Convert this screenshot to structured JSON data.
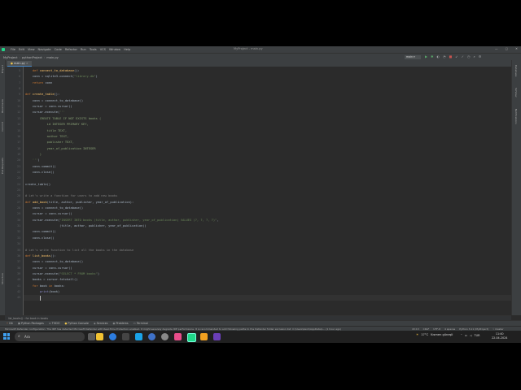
{
  "window": {
    "title": "MyProject - main.py",
    "menu": [
      "File",
      "Edit",
      "View",
      "Navigate",
      "Code",
      "Refactor",
      "Run",
      "Tools",
      "VCS",
      "Window",
      "Help"
    ],
    "controls": [
      "—",
      "▢",
      "✕"
    ]
  },
  "navbar": {
    "project": "MyProject",
    "folder": "pythonProject",
    "file": "main.py",
    "run_config": "main"
  },
  "tabs": [
    {
      "label": "main.py",
      "active": true
    }
  ],
  "side_left": [
    "Project",
    "Bookmarks",
    "Commit",
    "Pull Requests",
    "Structure"
  ],
  "side_right": [
    "Database",
    "SciView",
    "Notifications"
  ],
  "code_lines": [
    {
      "n": "5",
      "html": "    <span class='kw'>def</span> <span class='fn'>connect_to_database</span>():"
    },
    {
      "n": "6",
      "html": "    conn = sqlite3.connect(<span class='str'>\"library.db\"</span>)"
    },
    {
      "n": "7",
      "html": "    <span class='kw'>return</span> conn"
    },
    {
      "n": "8",
      "html": ""
    },
    {
      "n": "9",
      "html": "<span class='kw'>def</span> <span class='fn'>create_table</span>():"
    },
    {
      "n": "10",
      "html": "    conn = connect_to_database()"
    },
    {
      "n": "11",
      "html": "    cursor = conn.cursor()"
    },
    {
      "n": "12",
      "html": "    cursor.execute(<span class='str'>'''</span>"
    },
    {
      "n": "13",
      "html": "<span class='sqlstr'>        CREATE TABLE IF NOT EXISTS books (</span>"
    },
    {
      "n": "14",
      "html": "<span class='sqlstr'>            id INTEGER PRIMARY KEY,</span>"
    },
    {
      "n": "15",
      "html": "<span class='sqlstr'>            title TEXT,</span>"
    },
    {
      "n": "16",
      "html": "<span class='sqlstr'>            author TEXT,</span>"
    },
    {
      "n": "17",
      "html": "<span class='sqlstr'>            publisher TEXT,</span>"
    },
    {
      "n": "18",
      "html": "<span class='sqlstr'>            year_of_publication INTEGER</span>"
    },
    {
      "n": "19",
      "html": "<span class='sqlstr'>        )</span>"
    },
    {
      "n": "20",
      "html": "<span class='str'>    '''</span>)"
    },
    {
      "n": "21",
      "html": "    conn.commit()"
    },
    {
      "n": "22",
      "html": "    conn.close()"
    },
    {
      "n": "23",
      "html": ""
    },
    {
      "n": "24",
      "html": "create_table()"
    },
    {
      "n": "25",
      "html": ""
    },
    {
      "n": "26",
      "html": "<span class='cmt'># Let's write a function for users to add new books</span>"
    },
    {
      "n": "27",
      "html": "<span class='kw'>def</span> <span class='fn'>add_book</span>(title, author, publisher, year_of_publication):"
    },
    {
      "n": "28",
      "html": "    conn = connect_to_database()"
    },
    {
      "n": "29",
      "html": "    cursor = conn.cursor()"
    },
    {
      "n": "30",
      "html": "    cursor.execute(<span class='str'>\"INSERT INTO books (title, author, publisher, year_of_publication) VALUES (?, ?, ?, ?)\"</span>,"
    },
    {
      "n": "31",
      "html": "                   (title, author, publisher, year_of_publication))"
    },
    {
      "n": "32",
      "html": "    conn.commit()"
    },
    {
      "n": "33",
      "html": "    conn.close()"
    },
    {
      "n": "34",
      "html": ""
    },
    {
      "n": "35",
      "html": "<span class='cmt'># Let's write function to list all the books in the database</span>"
    },
    {
      "n": "36",
      "html": "<span class='kw'>def</span> <span class='fn'>list_books</span>():"
    },
    {
      "n": "37",
      "html": "    conn = connect_to_database()"
    },
    {
      "n": "38",
      "html": "    cursor = conn.cursor()"
    },
    {
      "n": "39",
      "html": "    cursor.execute(<span class='str'>\"SELECT * FROM books\"</span>)"
    },
    {
      "n": "40",
      "html": "    books = cursor.fetchall()"
    },
    {
      "n": "41",
      "html": "    <span class='kw'>for</span> book <span class='kw'>in</span> books:"
    },
    {
      "n": "42",
      "html": "        <span class='bi'>print</span>(book)"
    },
    {
      "n": "43",
      "html": "        "
    }
  ],
  "breadcrumb": "list_books()   ›   for book in books",
  "tool_windows": [
    "Git",
    "Python Packages",
    "TODO",
    "Python Console",
    "Services",
    "Problems",
    "Terminal"
  ],
  "status": {
    "message": "Microsoft Defender configuration: The IDE has detected Microsoft Defender with Real-Time Protection enabled. It might severely degrade IDE performance. It is recommended to add following paths to the Defender folder exclusion list: C:\\Users\\kaoh\\AppData\\L... (1 hour ago)",
    "position": "43:13",
    "line_sep": "CRLF",
    "encoding": "UTF-8",
    "indent": "4 spaces",
    "interpreter": "Python 3.11 (MyProject)",
    "branch": "master"
  },
  "taskbar": {
    "search": "Ara",
    "weather_temp": "17°C",
    "weather_text": "Kısmen güneşli",
    "lang": "TUR",
    "time": "11:40",
    "date": "22.04.2024"
  },
  "colors": {
    "editor_bg": "#2b2b2b",
    "keyword": "#cc7832",
    "function": "#ffc66d",
    "string": "#6a8759",
    "comment": "#808080",
    "run_green": "#59a869"
  }
}
